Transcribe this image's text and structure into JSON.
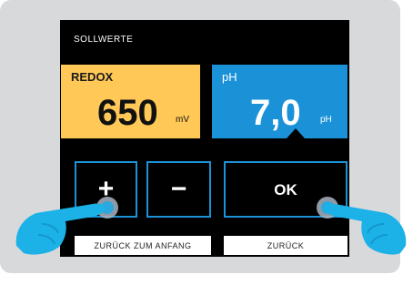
{
  "screen": {
    "title": "SOLLWERTE",
    "redox": {
      "label": "REDOX",
      "value": "650",
      "unit": "mV",
      "color": "#ffc857"
    },
    "ph": {
      "label": "pH",
      "value": "7,0",
      "unit": "pH",
      "color": "#1b92d8"
    }
  },
  "buttons": {
    "plus_label": "+",
    "minus_label": "−",
    "ok_label": "OK",
    "back_to_start_label": "ZURÜCK ZUM ANFANG",
    "back_label": "ZURÜCK"
  },
  "icons": {
    "left_hand": "pointing-hand-icon",
    "right_hand": "pointing-hand-icon"
  }
}
